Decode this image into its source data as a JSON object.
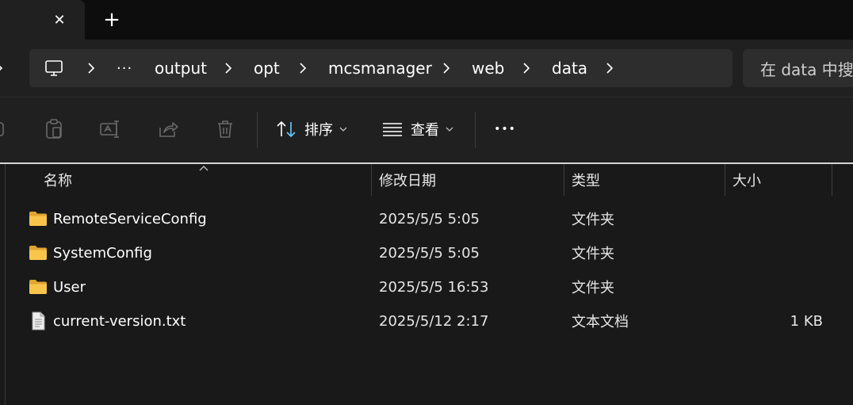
{
  "tabs": {
    "close_glyph": "✕",
    "new_tab_glyph": "+"
  },
  "address": {
    "breadcrumbs": [
      "output",
      "opt",
      "mcsmanager",
      "web",
      "data"
    ],
    "overflow_glyph": "···",
    "search_placeholder": "在 data 中搜索"
  },
  "toolbar": {
    "sort_label": "排序",
    "view_label": "查看",
    "more_glyph": "•••"
  },
  "columns": {
    "name": "名称",
    "date": "修改日期",
    "type": "类型",
    "size": "大小"
  },
  "files": [
    {
      "name": "RemoteServiceConfig",
      "date": "2025/5/5 5:05",
      "type": "文件夹",
      "size": "",
      "icon": "folder-icon"
    },
    {
      "name": "SystemConfig",
      "date": "2025/5/5 5:05",
      "type": "文件夹",
      "size": "",
      "icon": "folder-icon"
    },
    {
      "name": "User",
      "date": "2025/5/5 16:53",
      "type": "文件夹",
      "size": "",
      "icon": "folder-icon"
    },
    {
      "name": "current-version.txt",
      "date": "2025/5/12 2:17",
      "type": "文本文档",
      "size": "1 KB",
      "icon": "text-file-icon"
    }
  ],
  "colors": {
    "accent": "#60cdff",
    "folder": "#f8c54b",
    "background": "#191919"
  }
}
